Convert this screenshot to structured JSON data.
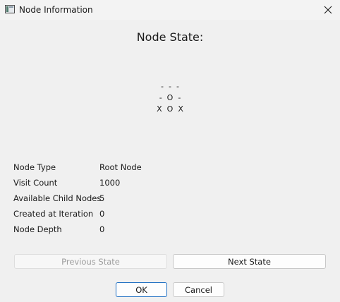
{
  "window": {
    "title": "Node Information",
    "icon": "app-icon",
    "close_icon": "close-icon"
  },
  "heading": "Node State:",
  "board": {
    "rows": [
      "-  -  -",
      "-  O  -",
      "X  O  X"
    ]
  },
  "info": [
    {
      "label": "Node Type",
      "value": "Root Node"
    },
    {
      "label": "Visit Count",
      "value": "1000"
    },
    {
      "label": "Available Child Nodes",
      "value": "5"
    },
    {
      "label": "Created at Iteration",
      "value": "0"
    },
    {
      "label": "Node Depth",
      "value": "0"
    }
  ],
  "buttons": {
    "previous": "Previous State",
    "next": "Next State",
    "ok": "OK",
    "cancel": "Cancel"
  },
  "colors": {
    "accent": "#1f6fc2",
    "background": "#f0f0f0"
  }
}
